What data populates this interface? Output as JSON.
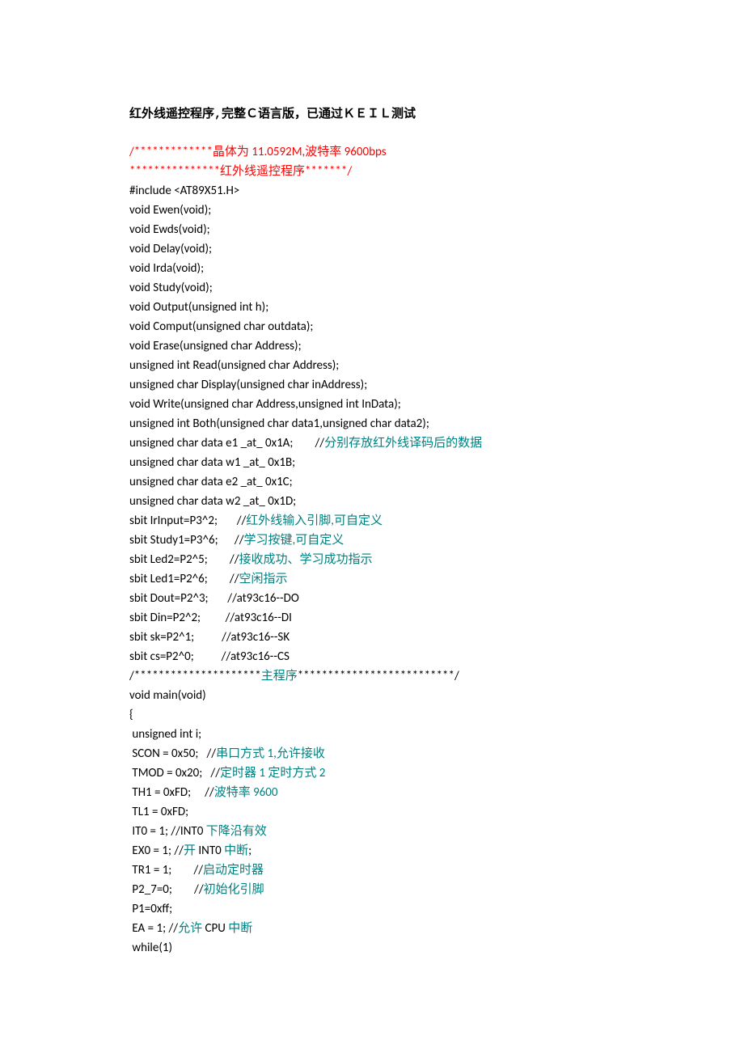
{
  "title": "红外线遥控程序,完整Ｃ语言版，已通过ＫＥＩＬ测试",
  "lines": [
    {
      "segs": [
        {
          "t": "/*************晶体为 11.0592M,波特率 9600bps",
          "c": "red"
        }
      ]
    },
    {
      "segs": [
        {
          "t": "***************红外线遥控程序*******/",
          "c": "red"
        }
      ]
    },
    {
      "segs": [
        {
          "t": "#include <AT89X51.H>"
        }
      ]
    },
    {
      "segs": [
        {
          "t": "void Ewen(void);"
        }
      ]
    },
    {
      "segs": [
        {
          "t": "void Ewds(void);"
        }
      ]
    },
    {
      "segs": [
        {
          "t": "void Delay(void);"
        }
      ]
    },
    {
      "segs": [
        {
          "t": "void Irda(void);"
        }
      ]
    },
    {
      "segs": [
        {
          "t": "void Study(void);"
        }
      ]
    },
    {
      "segs": [
        {
          "t": "void Output(unsigned int h);"
        }
      ]
    },
    {
      "segs": [
        {
          "t": "void Comput(unsigned char outdata);"
        }
      ]
    },
    {
      "segs": [
        {
          "t": "void Erase(unsigned char Address);"
        }
      ]
    },
    {
      "segs": [
        {
          "t": "unsigned int Read(unsigned char Address);"
        }
      ]
    },
    {
      "segs": [
        {
          "t": "unsigned char Display(unsigned char inAddress);"
        }
      ]
    },
    {
      "segs": [
        {
          "t": "void Write(unsigned char Address,unsigned int InData);"
        }
      ]
    },
    {
      "segs": [
        {
          "t": "unsigned int Both(unsigned char data1,unsigned char data2);"
        }
      ]
    },
    {
      "segs": [
        {
          "t": "unsigned char data e1 _at_ 0x1A;        //"
        },
        {
          "t": "分别存放红外线译码后的数据",
          "c": "teal"
        }
      ]
    },
    {
      "segs": [
        {
          "t": "unsigned char data w1 _at_ 0x1B;"
        }
      ]
    },
    {
      "segs": [
        {
          "t": "unsigned char data e2 _at_ 0x1C;"
        }
      ]
    },
    {
      "segs": [
        {
          "t": "unsigned char data w2 _at_ 0x1D;"
        }
      ]
    },
    {
      "segs": [
        {
          "t": "sbit IrInput=P3^2;       //"
        },
        {
          "t": "红外线输入引脚,可自定义",
          "c": "teal"
        }
      ]
    },
    {
      "segs": [
        {
          "t": "sbit Study1=P3^6;      //"
        },
        {
          "t": "学习按键,可自定义",
          "c": "teal"
        }
      ]
    },
    {
      "segs": [
        {
          "t": "sbit Led2=P2^5;        //"
        },
        {
          "t": "接收成功、学习成功指示",
          "c": "teal"
        }
      ]
    },
    {
      "segs": [
        {
          "t": "sbit Led1=P2^6;        //"
        },
        {
          "t": "空闲指示",
          "c": "teal"
        }
      ]
    },
    {
      "segs": [
        {
          "t": "sbit Dout=P2^3;       //at93c16--DO"
        }
      ]
    },
    {
      "segs": [
        {
          "t": "sbit Din=P2^2;         //at93c16--DI"
        }
      ]
    },
    {
      "segs": [
        {
          "t": "sbit sk=P2^1;          //at93c16--SK"
        }
      ]
    },
    {
      "segs": [
        {
          "t": "sbit cs=P2^0;          //at93c16--CS"
        }
      ]
    },
    {
      "segs": [
        {
          "t": "/*********************"
        },
        {
          "t": "主程序",
          "c": "teal"
        },
        {
          "t": "**************************/"
        }
      ]
    },
    {
      "segs": [
        {
          "t": "void main(void)"
        }
      ]
    },
    {
      "segs": [
        {
          "t": "{"
        }
      ]
    },
    {
      "segs": [
        {
          "t": " unsigned int i;"
        }
      ]
    },
    {
      "segs": [
        {
          "t": " SCON = 0x50;   //"
        },
        {
          "t": "串口方式 1,允许接收",
          "c": "teal"
        }
      ]
    },
    {
      "segs": [
        {
          "t": " TMOD = 0x20;   //"
        },
        {
          "t": "定时器 1 定时方式 2",
          "c": "teal"
        }
      ]
    },
    {
      "segs": [
        {
          "t": " TH1 = 0xFD;     //"
        },
        {
          "t": "波特率 9600",
          "c": "teal"
        }
      ]
    },
    {
      "segs": [
        {
          "t": " TL1 = 0xFD;"
        }
      ]
    },
    {
      "segs": [
        {
          "t": " IT0 = 1; //INT0 "
        },
        {
          "t": "下降沿有效",
          "c": "teal"
        }
      ]
    },
    {
      "segs": [
        {
          "t": " EX0 = 1; //"
        },
        {
          "t": "开 ",
          "c": "teal"
        },
        {
          "t": "INT0 "
        },
        {
          "t": "中断",
          "c": "teal"
        },
        {
          "t": ";"
        }
      ]
    },
    {
      "segs": [
        {
          "t": " TR1 = 1;        //"
        },
        {
          "t": "启动定时器",
          "c": "teal"
        }
      ]
    },
    {
      "segs": [
        {
          "t": " P2_7=0;        //"
        },
        {
          "t": "初始化引脚",
          "c": "teal"
        }
      ]
    },
    {
      "segs": [
        {
          "t": " P1=0xff;"
        }
      ]
    },
    {
      "segs": [
        {
          "t": " EA = 1; //"
        },
        {
          "t": "允许 ",
          "c": "teal"
        },
        {
          "t": "CPU "
        },
        {
          "t": "中断",
          "c": "teal"
        }
      ]
    },
    {
      "segs": [
        {
          "t": " while(1)"
        }
      ]
    }
  ]
}
